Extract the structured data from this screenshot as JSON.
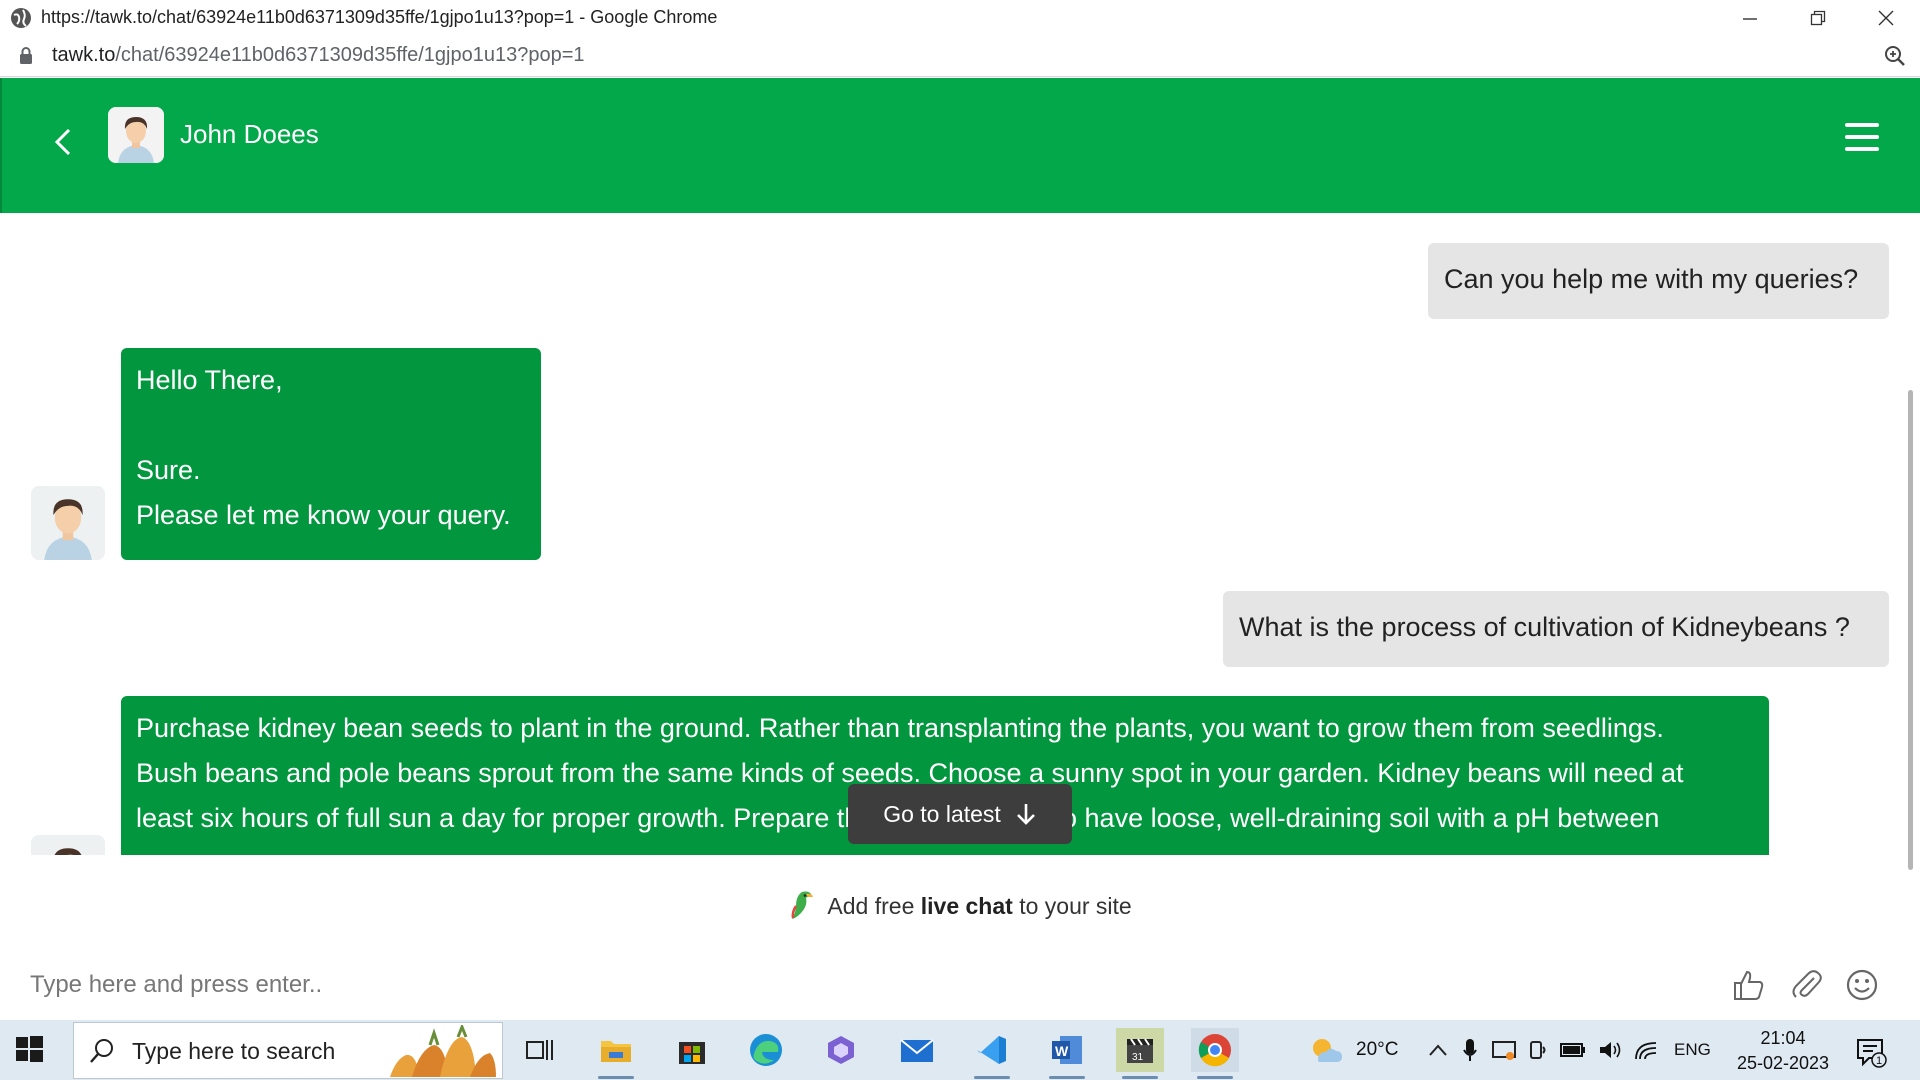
{
  "browser": {
    "window_title": "https://tawk.to/chat/63924e11b0d6371309d35ffe/1gjpo1u13?pop=1 - Google Chrome",
    "url_domain": "tawk.to",
    "url_path": "/chat/63924e11b0d6371309d35ffe/1gjpo1u13?pop=1"
  },
  "header": {
    "agent_name": "John Doees",
    "color": "#02a84a"
  },
  "messages": [
    {
      "sender": "visitor",
      "text": "Can you help me with my queries?"
    },
    {
      "sender": "agent",
      "lines": [
        "Hello There,",
        "",
        "Sure.",
        "Please let me know your query."
      ]
    },
    {
      "sender": "visitor",
      "text": "What is the process of cultivation of Kidneybeans ?"
    },
    {
      "sender": "agent",
      "lines": [
        "Purchase kidney bean seeds to plant in the ground. Rather than transplanting the plants, you want to grow them from seedlings.",
        "Bush beans and pole beans sprout from the same kinds of seeds. Choose a sunny spot in your garden. Kidney beans will need at",
        "least six hours of full sun a day for proper growth. Prepare the soil. You want to have loose, well-draining soil with a pH between"
      ]
    }
  ],
  "go_latest_label": "Go to latest",
  "promo": {
    "prefix": "Add free",
    "bold": "live chat",
    "suffix": "to your site"
  },
  "composer": {
    "placeholder": "Type here and press enter.."
  },
  "taskbar": {
    "search_placeholder": "Type here to search",
    "temperature": "20°C",
    "language": "ENG",
    "time": "21:04",
    "date": "25-02-2023",
    "notification_count": "1"
  },
  "colors": {
    "agent_bubble": "#02973f",
    "visitor_bubble": "#e5e5e5"
  }
}
